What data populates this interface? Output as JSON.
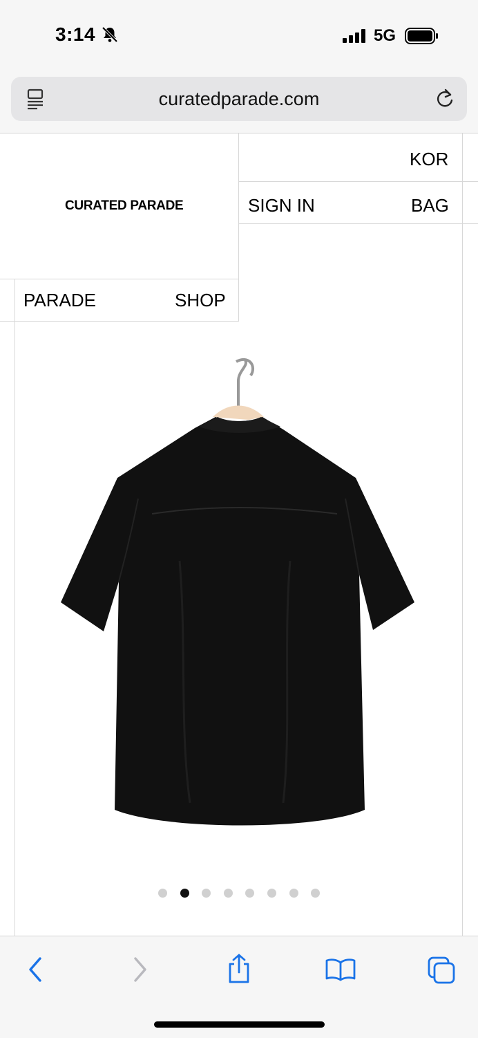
{
  "status_bar": {
    "time": "3:14",
    "network": "5G",
    "icons": [
      "bell-slash-icon",
      "signal-icon",
      "battery-icon"
    ]
  },
  "browser": {
    "url": "curatedparade.com",
    "icons": [
      "tab-overview-icon",
      "reload-icon"
    ]
  },
  "site": {
    "brand": "CURATED PARADE",
    "nav": {
      "kor": "KOR",
      "sign_in": "SIGN IN",
      "bag": "BAG",
      "parade": "PARADE",
      "shop": "SHOP"
    }
  },
  "product": {
    "image": "black short-sleeve shirt on wooden hanger, back view",
    "carousel": {
      "total": 8,
      "active_index": 1
    }
  },
  "toolbar": {
    "icons": [
      "back-icon",
      "forward-icon",
      "share-icon",
      "bookmarks-icon",
      "tabs-icon"
    ]
  },
  "colors": {
    "accent": "#1a73e8",
    "disabled": "#b9b9be",
    "divider": "#d8d8d8"
  }
}
